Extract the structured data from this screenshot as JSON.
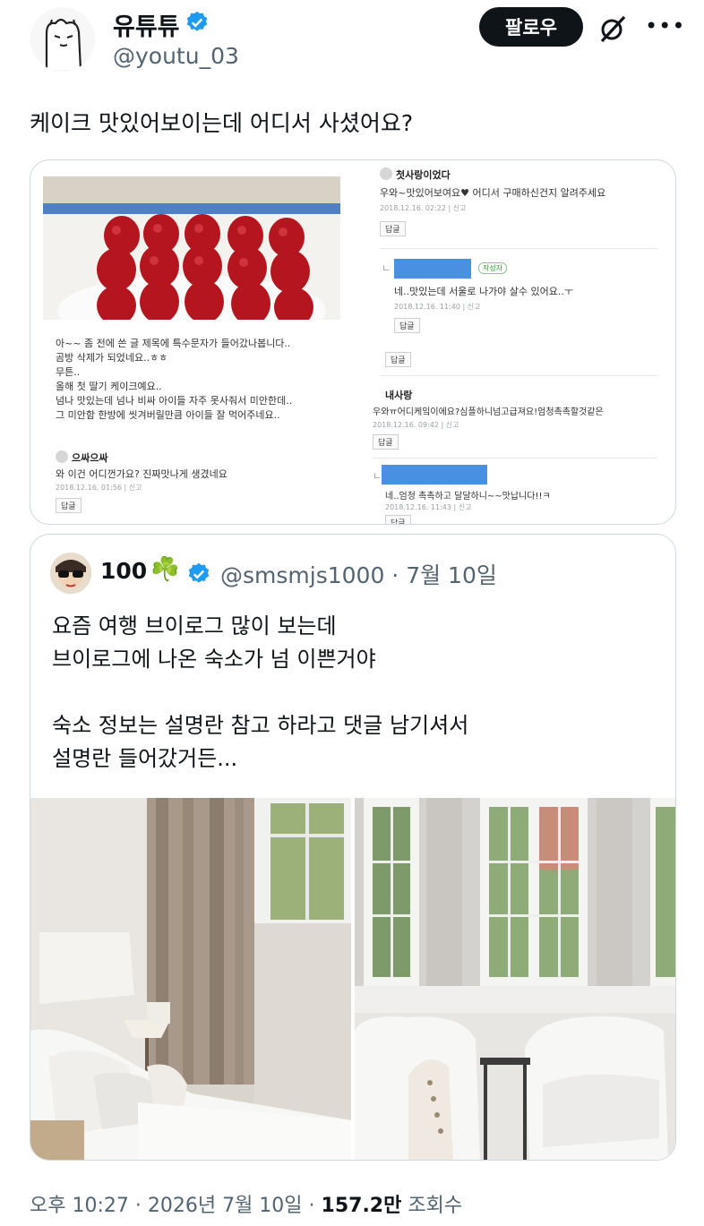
{
  "author": {
    "name": "유튜튜",
    "handle": "@youtu_03",
    "verified": true,
    "avatar_icon": "bear-doodle-avatar"
  },
  "actions": {
    "follow_label": "팔로우",
    "grok_icon": "grok-icon",
    "more_label": "•••"
  },
  "tweet": {
    "text": "케이크 맛있어보이는데 어디서 사셨어요?"
  },
  "screenshot": {
    "left": {
      "post_lines": [
        "아~~ 좀 전에 쓴 글 제목에 특수문자가 들어갔나봅니다..",
        "곰방 삭제가 되었네요..ㅎㅎ",
        "무튼..",
        "올해 첫 딸기 케이크예요..",
        "넘나 맛있는데 넘나 비싸 아이들 자주 못사줘서 미안한데..",
        "그 미안함 한방에 씻겨버릴만큼 아이들 잘 먹어주네요.."
      ],
      "comment": {
        "user": "으싸으싸",
        "text": "와 이건 어디껀가요? 진짜맛나게 생겼네요",
        "meta": "2018.12.16. 01:56  |  신고",
        "reply": "답글"
      }
    },
    "right": [
      {
        "user": "첫사랑이었다",
        "text": "우와~맛있어보여요♥ 어디서 구매하신건지 알려주세요",
        "meta": "2018.12.16. 02:22  |  신고",
        "reply": "답글"
      },
      {
        "tag": "작성자",
        "text": "네..맛있는데 서울로 나가야 살수 있어요..ㅜ",
        "meta": "2018.12.16. 11:40  |  신고",
        "reply": "답글"
      },
      {
        "reply": "답글"
      },
      {
        "user": "내사랑",
        "text": "우와ㅠ어디케잌이에요?심플하니넘고급져요!엄청촉촉할것같은",
        "meta": "2018.12.16. 09:42  |  신고",
        "reply": "답글"
      },
      {
        "text": "네..엄청 촉촉하고 달달하니~~맛납니다!!ㅋ",
        "meta": "2018.12.16. 11:43  |  신고",
        "reply": "답글"
      }
    ]
  },
  "quote": {
    "name": "100",
    "emoji": "☘️",
    "verified": true,
    "handle_date": "@smsmjs1000 · 7월 10일",
    "body": "요즘 여행 브이로그 많이 보는데\n브이로그에 나온 숙소가 넘 이쁜거야\n\n숙소 정보는 설명란 참고 하라고 댓글 남기셔서\n설명란 들어갔거든..."
  },
  "footer": {
    "time": "오후 10:27 · 2026년 7월 10일 · ",
    "views": "157.2만",
    "views_label": " 조회수"
  },
  "colors": {
    "verified": "#1d9bf0",
    "follow_bg": "#0f1419",
    "secondary_text": "#536471",
    "border": "#cfd9de"
  }
}
